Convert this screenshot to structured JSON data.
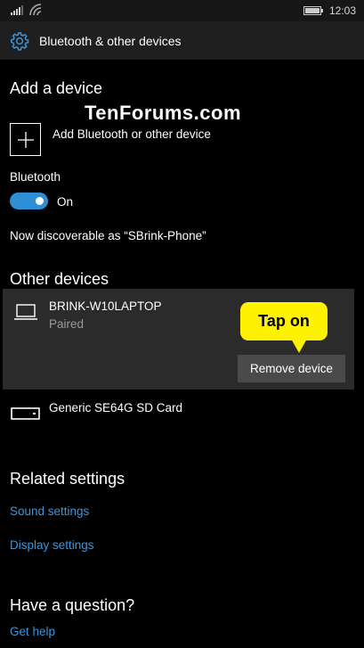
{
  "status_bar": {
    "time": "12:03"
  },
  "title_bar": {
    "title": "Bluetooth & other devices"
  },
  "watermark": "TenForums.com",
  "add_device": {
    "heading": "Add a device",
    "button_label": "Add Bluetooth or other device"
  },
  "bluetooth": {
    "label": "Bluetooth",
    "state": "On",
    "discoverable_text": "Now discoverable as “SBrink-Phone”"
  },
  "other_devices": {
    "heading": "Other devices",
    "items": [
      {
        "name": "BRINK-W10LAPTOP",
        "status": "Paired",
        "icon": "laptop-icon",
        "action": "Remove device"
      },
      {
        "name": "Generic SE64G SD Card",
        "icon": "storage-icon"
      }
    ]
  },
  "callout": {
    "text": "Tap on",
    "color": "#fff200"
  },
  "related_settings": {
    "heading": "Related settings",
    "links": [
      "Sound settings",
      "Display settings"
    ]
  },
  "help": {
    "heading": "Have a question?",
    "link": "Get help"
  },
  "colors": {
    "accent": "#2e8fd6",
    "link": "#3a96dd",
    "background": "#000000"
  }
}
